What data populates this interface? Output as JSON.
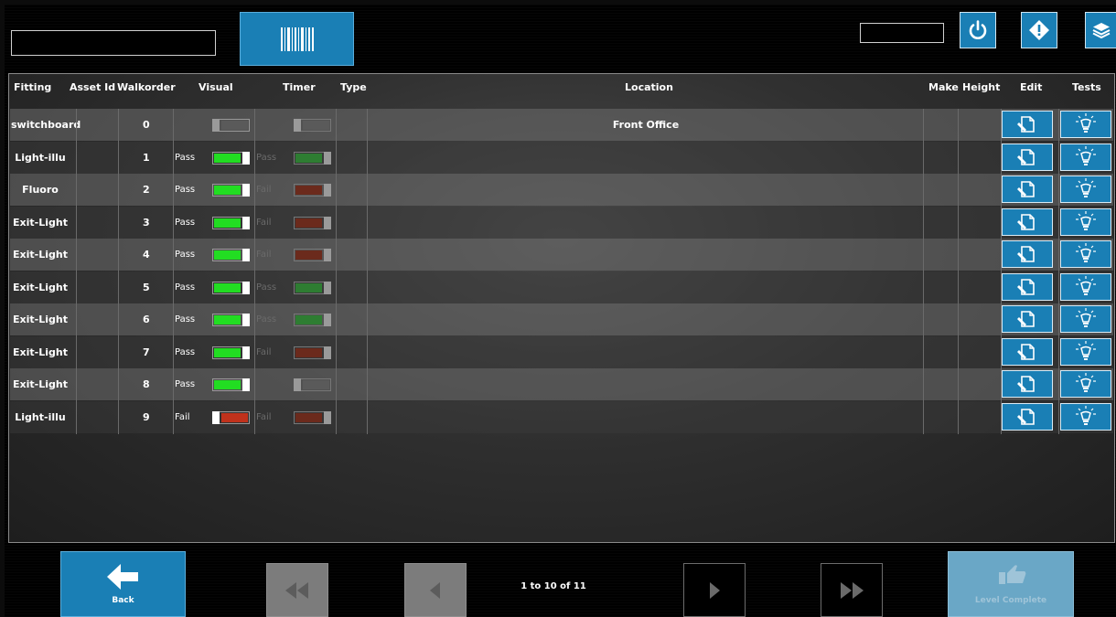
{
  "toolbar": {
    "search_value": "",
    "code_value": "",
    "barcode_icon": "barcode-icon",
    "power_icon": "power-icon",
    "alert_icon": "alert-diamond-icon",
    "layers_icon": "layers-icon"
  },
  "table": {
    "headers": {
      "fitting": "Fitting",
      "asset_id": "Asset Id",
      "walkorder": "Walkorder",
      "visual": "Visual",
      "timer": "Timer",
      "type": "Type",
      "location": "Location",
      "make": "Make",
      "height": "Height",
      "edit": "Edit",
      "tests": "Tests"
    },
    "rows": [
      {
        "fitting": "switchboard",
        "walkorder": "0",
        "visual_label": "",
        "visual_state": "none",
        "timer_label": "",
        "timer_state": "none",
        "location": "Front Office"
      },
      {
        "fitting": "Light-illu",
        "walkorder": "1",
        "visual_label": "Pass",
        "visual_state": "pass",
        "timer_label": "Pass",
        "timer_state": "pass",
        "location": ""
      },
      {
        "fitting": "Fluoro",
        "walkorder": "2",
        "visual_label": "Pass",
        "visual_state": "pass",
        "timer_label": "Fail",
        "timer_state": "fail",
        "location": ""
      },
      {
        "fitting": "Exit-Light",
        "walkorder": "3",
        "visual_label": "Pass",
        "visual_state": "pass",
        "timer_label": "Fail",
        "timer_state": "fail",
        "location": ""
      },
      {
        "fitting": "Exit-Light",
        "walkorder": "4",
        "visual_label": "Pass",
        "visual_state": "pass",
        "timer_label": "Fail",
        "timer_state": "fail",
        "location": ""
      },
      {
        "fitting": "Exit-Light",
        "walkorder": "5",
        "visual_label": "Pass",
        "visual_state": "pass",
        "timer_label": "Pass",
        "timer_state": "pass",
        "location": ""
      },
      {
        "fitting": "Exit-Light",
        "walkorder": "6",
        "visual_label": "Pass",
        "visual_state": "pass",
        "timer_label": "Pass",
        "timer_state": "pass",
        "location": ""
      },
      {
        "fitting": "Exit-Light",
        "walkorder": "7",
        "visual_label": "Pass",
        "visual_state": "pass",
        "timer_label": "Fail",
        "timer_state": "fail",
        "location": ""
      },
      {
        "fitting": "Exit-Light",
        "walkorder": "8",
        "visual_label": "Pass",
        "visual_state": "pass",
        "timer_label": "",
        "timer_state": "none",
        "location": ""
      },
      {
        "fitting": "Light-illu",
        "walkorder": "9",
        "visual_label": "Fail",
        "visual_state": "fail",
        "timer_label": "Fail",
        "timer_state": "fail",
        "location": ""
      }
    ],
    "edit_icon": "edit-document-icon",
    "tests_icon": "lightbulb-icon"
  },
  "footer": {
    "back_label": "Back",
    "pager_text": "1 to 10 of 11",
    "complete_label": "Level Complete"
  },
  "colors": {
    "accent": "#1a7fb5",
    "visual_pass": "#22dd22",
    "visual_fail": "#c0321c",
    "timer_pass": "#2e7d32",
    "timer_fail": "#6b2a1c",
    "off": "#5a5a5a"
  }
}
